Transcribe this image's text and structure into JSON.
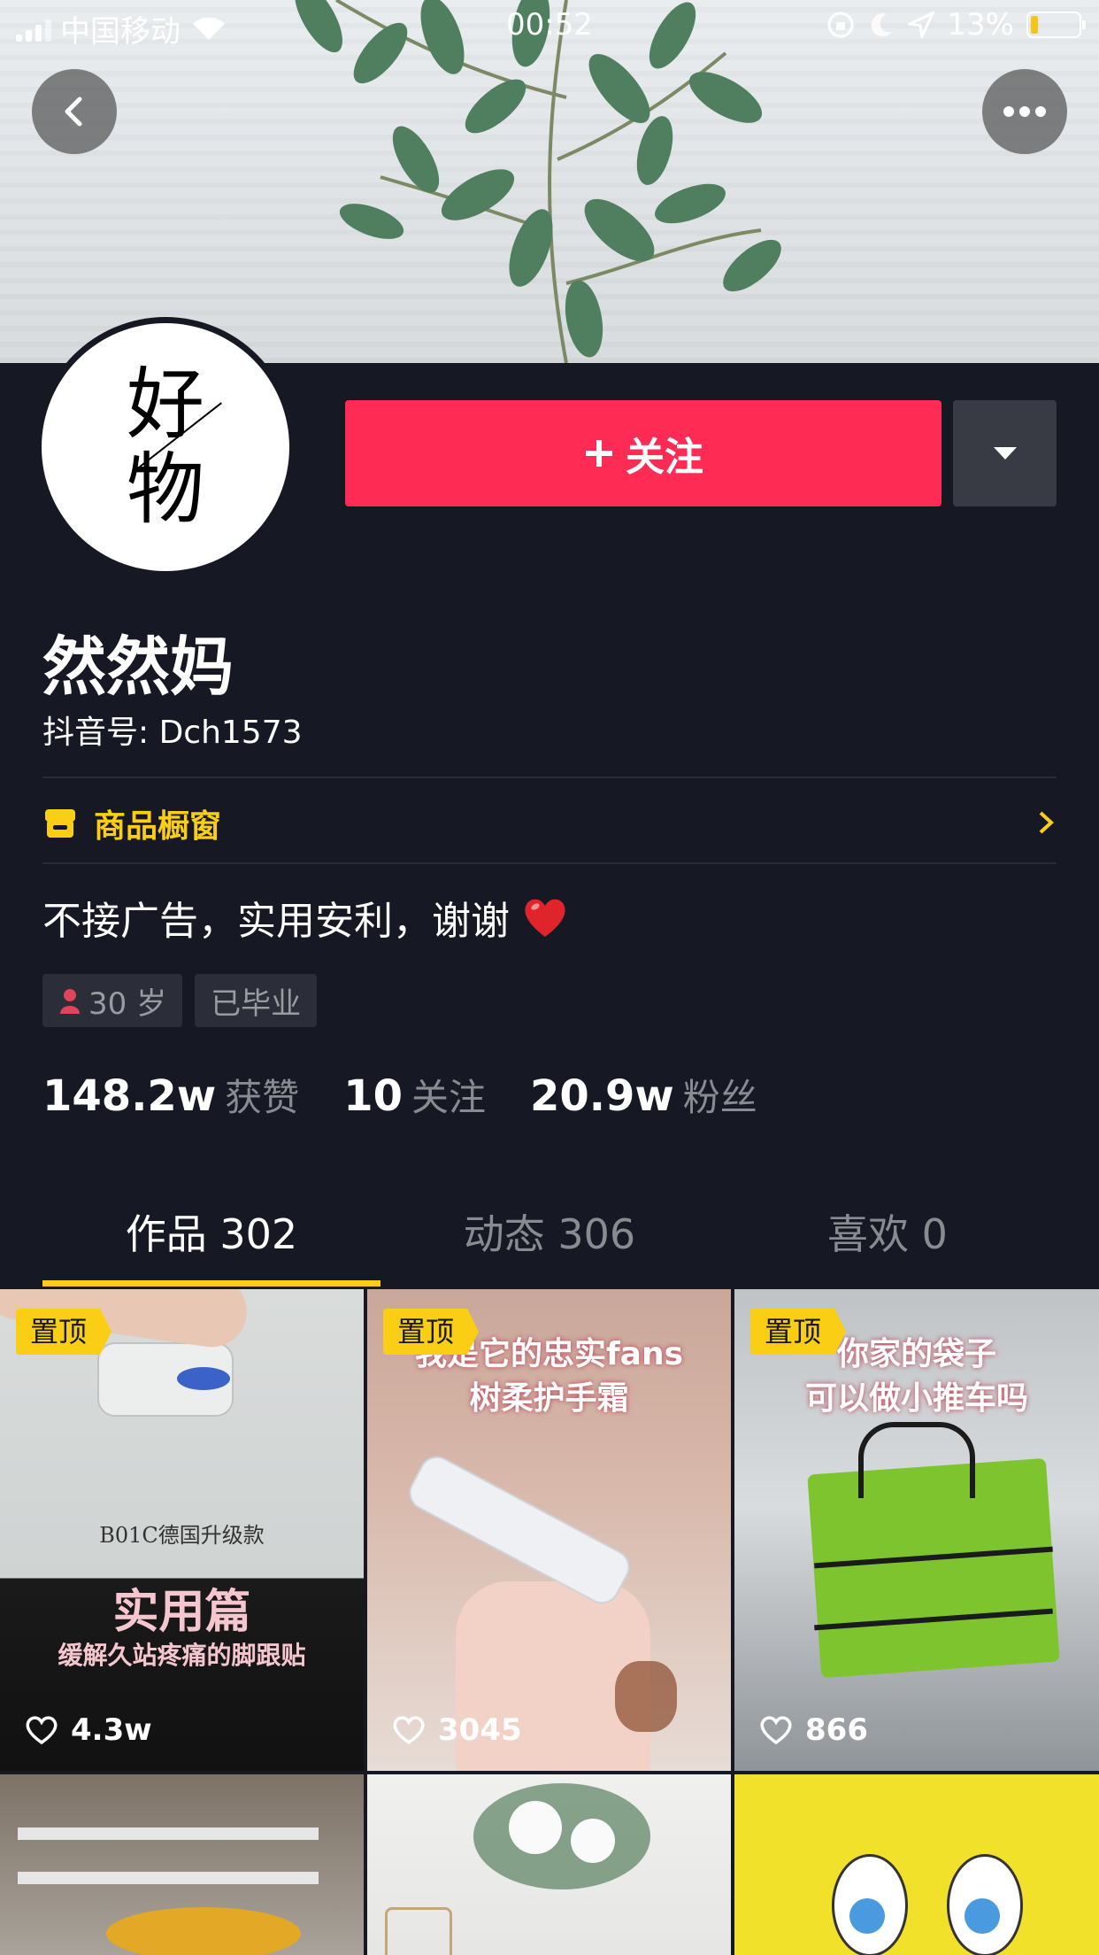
{
  "status_bar": {
    "carrier": "中国移动",
    "time": "00:52",
    "battery": "13%",
    "battery_level": 0.13
  },
  "header": {
    "back_icon": "chevron-left-icon",
    "more_icon": "ellipsis-icon"
  },
  "profile": {
    "avatar_text_top": "好",
    "avatar_text_bottom": "物",
    "follow_label": "关注",
    "name": "然然妈",
    "douyin_id": "抖音号: Dch1573",
    "shop_label": "商品橱窗",
    "bio": "不接广告，实用安利，谢谢",
    "tags": [
      {
        "label": "30 岁",
        "icon": "female-icon"
      },
      {
        "label": "已毕业"
      }
    ],
    "stats": [
      {
        "value": "148.2w",
        "label": "获赞"
      },
      {
        "value": "10",
        "label": "关注"
      },
      {
        "value": "20.9w",
        "label": "粉丝"
      }
    ]
  },
  "tabs": [
    {
      "label": "作品 302",
      "active": true
    },
    {
      "label": "动态 306",
      "active": false
    },
    {
      "label": "喜欢 0",
      "active": false
    }
  ],
  "videos": [
    {
      "pinned": "置顶",
      "likes": "4.3w",
      "caption_small": "B01C德国升级款",
      "caption_big": "实用篇",
      "caption_sub": "缓解久站疼痛的脚跟贴"
    },
    {
      "pinned": "置顶",
      "likes": "3045",
      "caption_line1": "我是它的忠实fans",
      "caption_line2": "树柔护手霜"
    },
    {
      "pinned": "置顶",
      "likes": "866",
      "caption_line1": "你家的袋子",
      "caption_line2": "可以做小推车吗"
    },
    {},
    {},
    {}
  ],
  "colors": {
    "background": "#161823",
    "follow": "#fe2c55",
    "accent": "#face15"
  }
}
